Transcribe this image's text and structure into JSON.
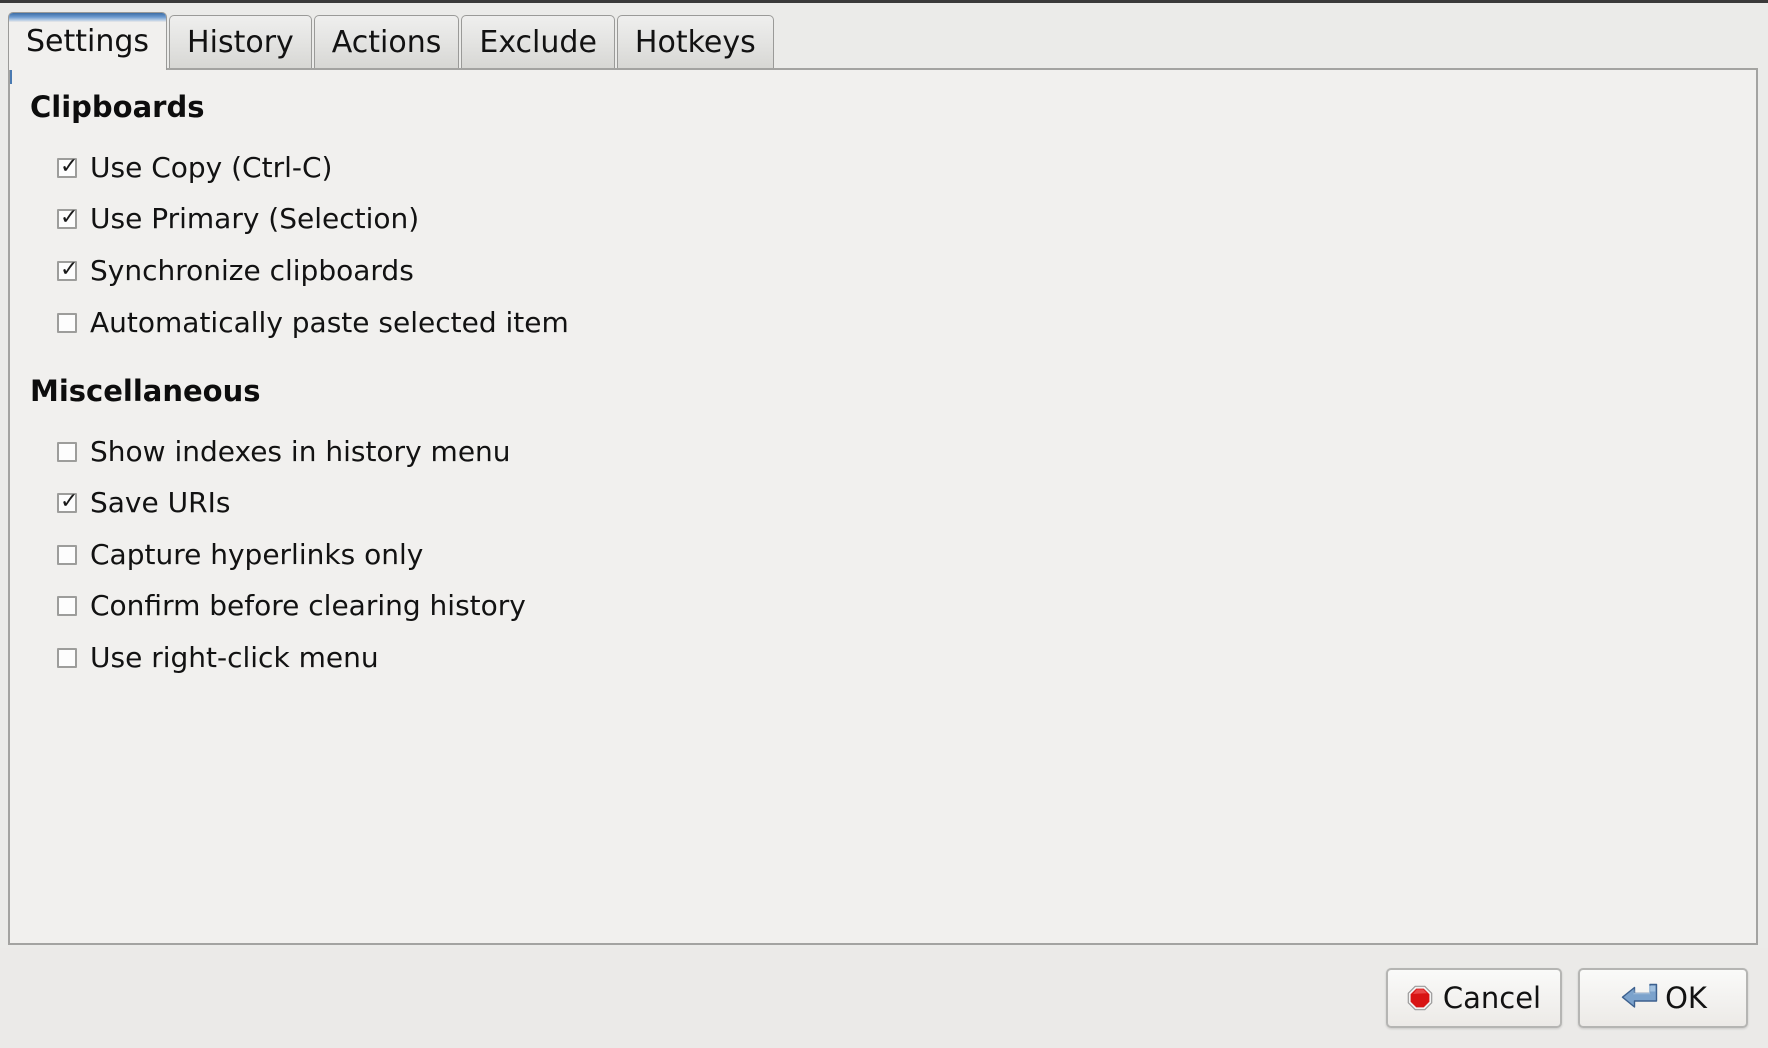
{
  "window": {
    "active_tab": "Settings"
  },
  "tabs": [
    {
      "label": "Settings",
      "active": true
    },
    {
      "label": "History",
      "active": false
    },
    {
      "label": "Actions",
      "active": false
    },
    {
      "label": "Exclude",
      "active": false
    },
    {
      "label": "Hotkeys",
      "active": false
    }
  ],
  "sections": {
    "clipboards": {
      "title": "Clipboards",
      "options": [
        {
          "label": "Use Copy (Ctrl-C)",
          "checked": true
        },
        {
          "label": "Use Primary (Selection)",
          "checked": true
        },
        {
          "label": "Synchronize clipboards",
          "checked": true
        },
        {
          "label": "Automatically paste selected item",
          "checked": false
        }
      ]
    },
    "miscellaneous": {
      "title": "Miscellaneous",
      "options": [
        {
          "label": "Show indexes in history menu",
          "checked": false
        },
        {
          "label": "Save URIs",
          "checked": true
        },
        {
          "label": "Capture hyperlinks only",
          "checked": false
        },
        {
          "label": "Confirm before clearing history",
          "checked": false
        },
        {
          "label": "Use right-click menu",
          "checked": false
        }
      ]
    }
  },
  "actions": {
    "cancel": {
      "label": "Cancel",
      "icon": "stop-octagon-icon"
    },
    "ok": {
      "label": "OK",
      "icon": "enter-return-arrow-icon"
    }
  },
  "colors": {
    "active_tab_accent": "#3d6ea5",
    "panel_background": "#f1f0ee",
    "window_background": "#ebebe9",
    "border": "#a3a3a1",
    "cancel_icon": "#d81414",
    "ok_icon": "#7ba2cc",
    "text": "#121212"
  },
  "checkmark_glyph": "✓"
}
